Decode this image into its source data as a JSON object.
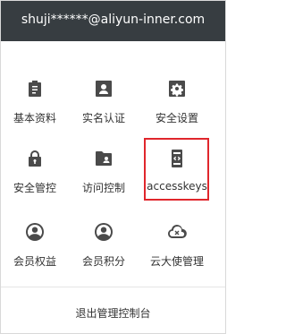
{
  "header": {
    "email": "shuji******@aliyun-inner.com"
  },
  "menu": [
    {
      "label": "基本资料",
      "icon": "clipboard-icon"
    },
    {
      "label": "实名认证",
      "icon": "id-card-icon"
    },
    {
      "label": "安全设置",
      "icon": "gear-icon"
    },
    {
      "label": "安全管控",
      "icon": "lock-icon"
    },
    {
      "label": "访问控制",
      "icon": "folder-user-icon"
    },
    {
      "label": "accesskeys",
      "icon": "code-phone-icon"
    },
    {
      "label": "会员权益",
      "icon": "user-circle-icon"
    },
    {
      "label": "会员积分",
      "icon": "user-circle-icon"
    },
    {
      "label": "云大使管理",
      "icon": "cloud-icon"
    }
  ],
  "footer": {
    "logout_label": "退出管理控制台"
  },
  "colors": {
    "header_bg": "#373d41",
    "icon": "#4a4a4a",
    "highlight": "#e0262c"
  }
}
